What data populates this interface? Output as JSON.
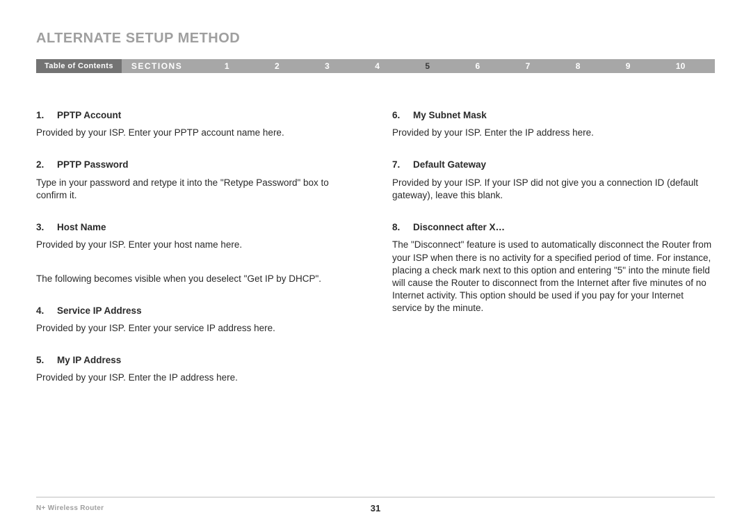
{
  "title": "ALTERNATE SETUP METHOD",
  "nav": {
    "toc": "Table of Contents",
    "sections_label": "SECTIONS",
    "items": [
      "1",
      "2",
      "3",
      "4",
      "5",
      "6",
      "7",
      "8",
      "9",
      "10"
    ],
    "active_index": 4
  },
  "left_col": {
    "items": [
      {
        "num": "1.",
        "title": "PPTP Account",
        "desc": "Provided by your ISP. Enter your PPTP account name here."
      },
      {
        "num": "2.",
        "title": "PPTP Password",
        "desc": "Type in your password and retype it into the \"Retype Password\" box to confirm it."
      },
      {
        "num": "3.",
        "title": "Host Name",
        "desc": "Provided by your ISP. Enter your host name here."
      }
    ],
    "note": "The following becomes visible when you deselect \"Get IP by DHCP\".",
    "items2": [
      {
        "num": "4.",
        "title": "Service IP Address",
        "desc": "Provided by your ISP. Enter your service IP address here."
      },
      {
        "num": "5.",
        "title": "My IP Address",
        "desc": "Provided by your ISP. Enter the IP address here."
      }
    ]
  },
  "right_col": {
    "items": [
      {
        "num": "6.",
        "title": "My Subnet Mask",
        "desc": "Provided by your ISP. Enter the IP address here."
      },
      {
        "num": "7.",
        "title": "Default Gateway",
        "desc": "Provided by your ISP. If your ISP did not give you a connection ID (default gateway), leave this blank."
      },
      {
        "num": "8.",
        "title": "Disconnect after X…",
        "desc": "The \"Disconnect\" feature is used to automatically disconnect the Router from your ISP when there is no activity for a specified period of time. For instance, placing a check mark next to this option and entering \"5\" into the minute field will cause the Router to disconnect from the Internet after five minutes of no Internet activity. This option should be used if you pay for your Internet service by the minute."
      }
    ]
  },
  "footer": {
    "left": "N+ Wireless Router",
    "page": "31"
  }
}
